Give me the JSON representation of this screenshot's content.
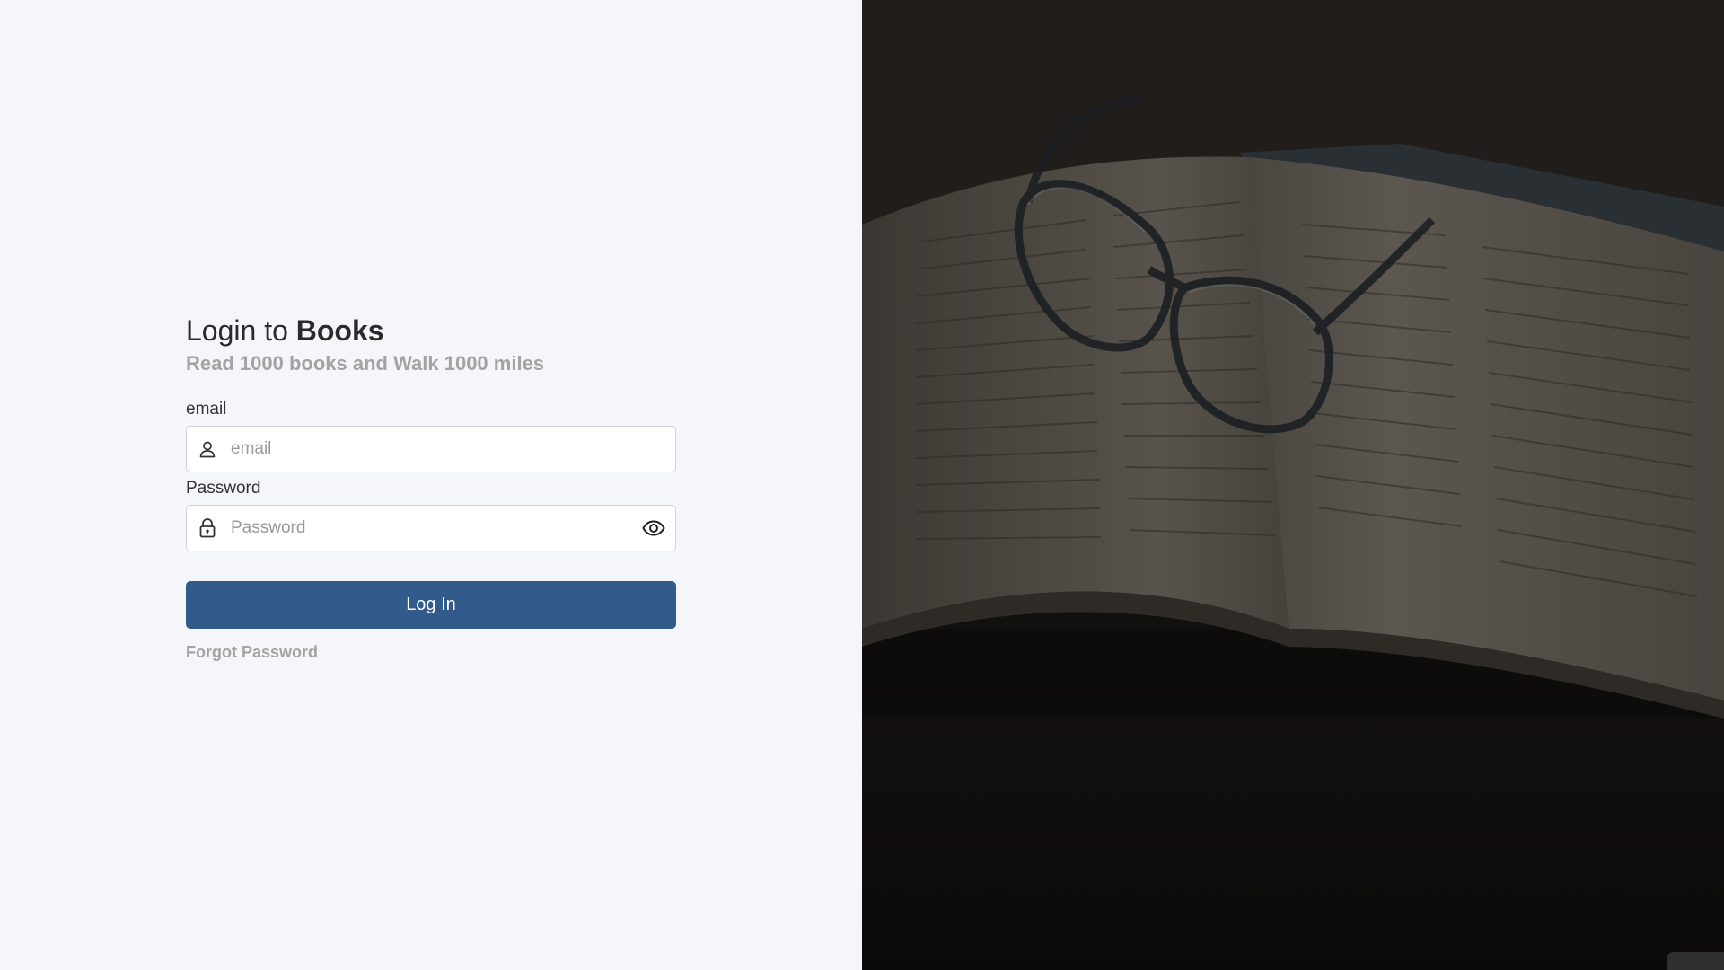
{
  "login": {
    "title_prefix": "Login to ",
    "title_brand": "Books",
    "subtitle": "Read 1000 books and Walk 1000 miles",
    "email": {
      "label": "email",
      "placeholder": "email",
      "value": "",
      "icon": "user-icon"
    },
    "password": {
      "label": "Password",
      "placeholder": "Password",
      "value": "",
      "icon": "lock-icon",
      "toggle_icon": "eye-icon"
    },
    "submit_label": "Log In",
    "forgot_label": "Forgot Password"
  },
  "hero": {
    "image": "open-book-with-glasses-photo"
  },
  "colors": {
    "left_bg": "#f5f6fa",
    "primary": "#325a8a",
    "muted_text": "#a3a3a3"
  }
}
